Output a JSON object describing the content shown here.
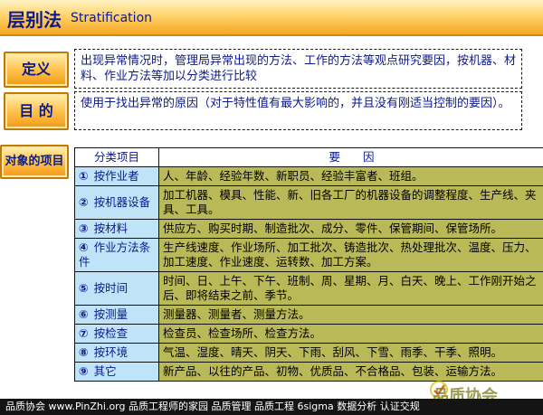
{
  "header": {
    "title_cn": "层别法",
    "title_en": "Stratification"
  },
  "labels": {
    "definition": "定义",
    "objective": "目 的",
    "target": "对象的项目"
  },
  "definition_text": "出现异常情况时，管理局异常出现的方法、工作的方法等观点研究要因，按机器、材料、作业方法等加以分类进行比较",
  "objective_text": "使用于找出异常的原因（对于特性值有最大影响的，并且没有刚适当控制的要因）。",
  "table": {
    "header_category": "分类项目",
    "header_factor": "要　　因",
    "rows": [
      {
        "num": "①",
        "category": "按作业者",
        "factor": "人、年龄、经验年数、新职员、经验丰富者、班组。"
      },
      {
        "num": "②",
        "category": "按机器设备",
        "factor": "加工机器、模具、性能、新、旧各工厂的机器设备的调整程度、生产线、夹具、工具。"
      },
      {
        "num": "③",
        "category": "按材料",
        "factor": "供应方、购买时期、制造批次、成分、零件、保管期间、保管场所。"
      },
      {
        "num": "④",
        "category": "作业方法条件",
        "factor": "生产线速度、作业场所、加工批次、铸造批次、热处理批次、温度、压力、加工速度、作业速度、运转数、加工方案。"
      },
      {
        "num": "⑤",
        "category": "按时间",
        "factor": "时间、日、上午、下午、班制、周、星期、月、白天、晚上、工作刚开始之后、即将结束之前、季节。"
      },
      {
        "num": "⑥",
        "category": "按测量",
        "factor": "测量器、测量者、测量方法。"
      },
      {
        "num": "⑦",
        "category": "按检查",
        "factor": "检查员、检查场所、检查方法。"
      },
      {
        "num": "⑧",
        "category": "按环境",
        "factor": "气温、湿度、晴天、阴天、下雨、刮风、下雪、雨季、干季、照明。"
      },
      {
        "num": "⑨",
        "category": "其它",
        "factor": "新产品、以往的产品、初物、优质品、不合格品、包装、运输方法。"
      }
    ]
  },
  "footer_text": "品质协会 www.PinZhi.org 品质工程师的家园 品质管理 品质工程 6sigma 数据分析 认证交规",
  "watermark_text": "品质协会",
  "colors": {
    "category_bg": "#bfe3f7",
    "factor_bg": "#b9b957",
    "title_text": "#0d1a8c",
    "button_orange": "#f29a14"
  }
}
